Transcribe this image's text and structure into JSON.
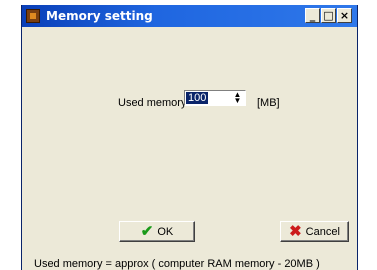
{
  "window": {
    "title": "Memory setting",
    "controls": {
      "minimize": "_",
      "maximize": "□",
      "close": "×"
    }
  },
  "form": {
    "used_memory_label": "Used memory",
    "used_memory_value": "100",
    "unit": "[MB]"
  },
  "buttons": {
    "ok_label": "OK",
    "cancel_label": "Cancel"
  },
  "status": "Used memory = approx ( computer RAM memory - 20MB )",
  "icons": {
    "app": "app-icon",
    "ok": "checkmark-icon",
    "cancel": "x-icon",
    "spinner": "spinner-arrows-icon"
  },
  "colors": {
    "titlebar": "#1f66e0",
    "window_bg": "#ece9d8",
    "selection": "#0a246a",
    "ok_icon": "#1a9a1a",
    "cancel_icon": "#cc1b1b"
  }
}
